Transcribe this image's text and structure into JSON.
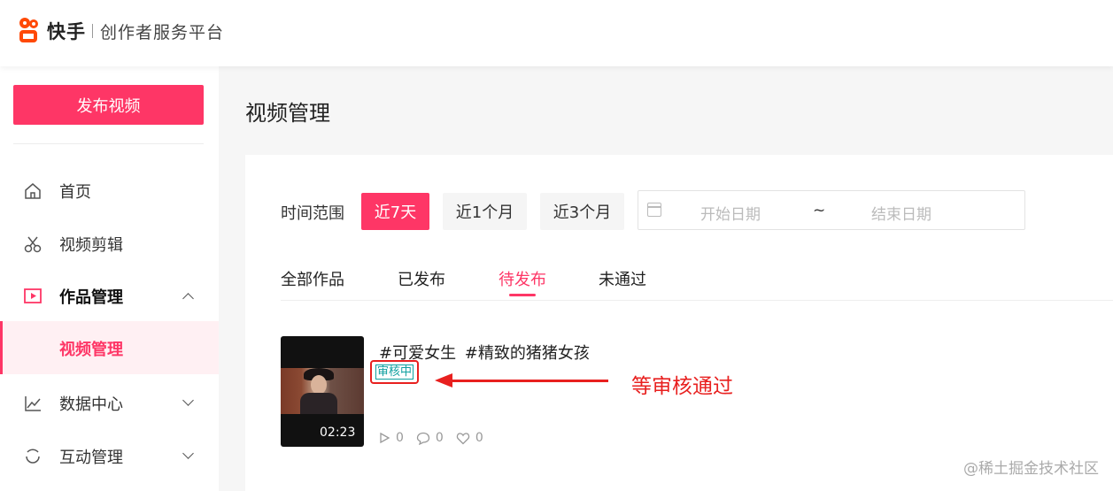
{
  "header": {
    "brand": "快手",
    "subtitle": "创作者服务平台"
  },
  "sidebar": {
    "publish_button": "发布视频",
    "items": [
      {
        "label": "首页",
        "icon": "home-icon"
      },
      {
        "label": "视频剪辑",
        "icon": "scissors-icon"
      },
      {
        "label": "作品管理",
        "icon": "play-square-icon"
      },
      {
        "label": "视频管理"
      },
      {
        "label": "数据中心",
        "icon": "chart-line-icon"
      },
      {
        "label": "互动管理",
        "icon": "refresh-icon"
      }
    ]
  },
  "main": {
    "title": "视频管理",
    "filter": {
      "label": "时间范围",
      "chips": [
        "近7天",
        "近1个月",
        "近3个月"
      ],
      "active_chip": "近7天",
      "start_placeholder": "开始日期",
      "separator": "~",
      "end_placeholder": "结束日期"
    },
    "tabs": [
      "全部作品",
      "已发布",
      "待发布",
      "未通过"
    ],
    "active_tab": "待发布",
    "video": {
      "title": "#可爱女生  #精致的猪猪女孩",
      "duration": "02:23",
      "status": "审核中",
      "plays": "0",
      "comments": "0",
      "likes": "0"
    },
    "annotation": "等审核通过"
  },
  "watermark": "@稀土掘金技术社区",
  "colors": {
    "accent": "#fe3666",
    "annotation": "#e8201f",
    "status": "#11a0a0"
  }
}
